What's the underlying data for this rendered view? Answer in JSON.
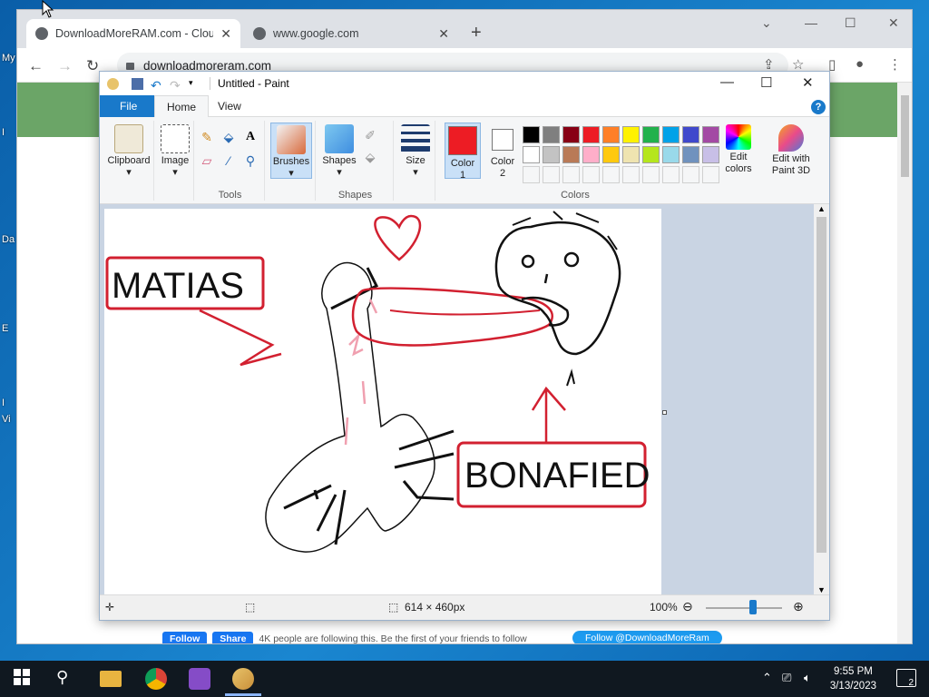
{
  "desktop": {
    "icon_labels": [
      "My",
      "I",
      "Da",
      "E",
      "I",
      "Vi"
    ]
  },
  "browser": {
    "tabs": [
      {
        "title": "DownloadMoreRAM.com - Cloud",
        "active": true
      },
      {
        "title": "www.google.com",
        "active": false
      }
    ],
    "new_tab": "+",
    "address": "downloadmoreram.com",
    "page": {
      "fb_follow": "Follow",
      "fb_share": "Share",
      "fb_text": "4K people are following this. Be the first of your friends to follow",
      "twitter": "Follow @DownloadMoreRam"
    }
  },
  "paint": {
    "title": "Untitled - Paint",
    "ribbon_tabs": {
      "file": "File",
      "home": "Home",
      "view": "View"
    },
    "groups": {
      "clipboard": "Clipboard",
      "image": "Image",
      "tools": "Tools",
      "brushes": "Brushes",
      "shapes": "Shapes",
      "shapes_label": "Shapes",
      "size": "Size",
      "color1": "Color",
      "color1_num": "1",
      "color2": "Color",
      "color2_num": "2",
      "colors": "Colors",
      "edit_colors": "Edit",
      "edit_colors2": "colors",
      "edit3d": "Edit with",
      "edit3d2": "Paint 3D"
    },
    "palette": [
      "#000000",
      "#7f7f7f",
      "#880015",
      "#ed1c24",
      "#ff7f27",
      "#fff200",
      "#22b14c",
      "#00a2e8",
      "#3f48cc",
      "#a349a4",
      "#ffffff",
      "#c3c3c3",
      "#b97a57",
      "#ffaec9",
      "#ffc90e",
      "#efe4b0",
      "#b5e61d",
      "#99d9ea",
      "#7092be",
      "#c8bfe7"
    ],
    "color1_hex": "#ed1c24",
    "color2_hex": "#ffffff",
    "drawing": {
      "label_left": "MATIAS",
      "label_right": "BONAFIED"
    },
    "status": {
      "size": "614 × 460px",
      "zoom": "100%"
    }
  },
  "taskbar": {
    "time": "9:55 PM",
    "date": "3/13/2023",
    "notifications": "2"
  }
}
